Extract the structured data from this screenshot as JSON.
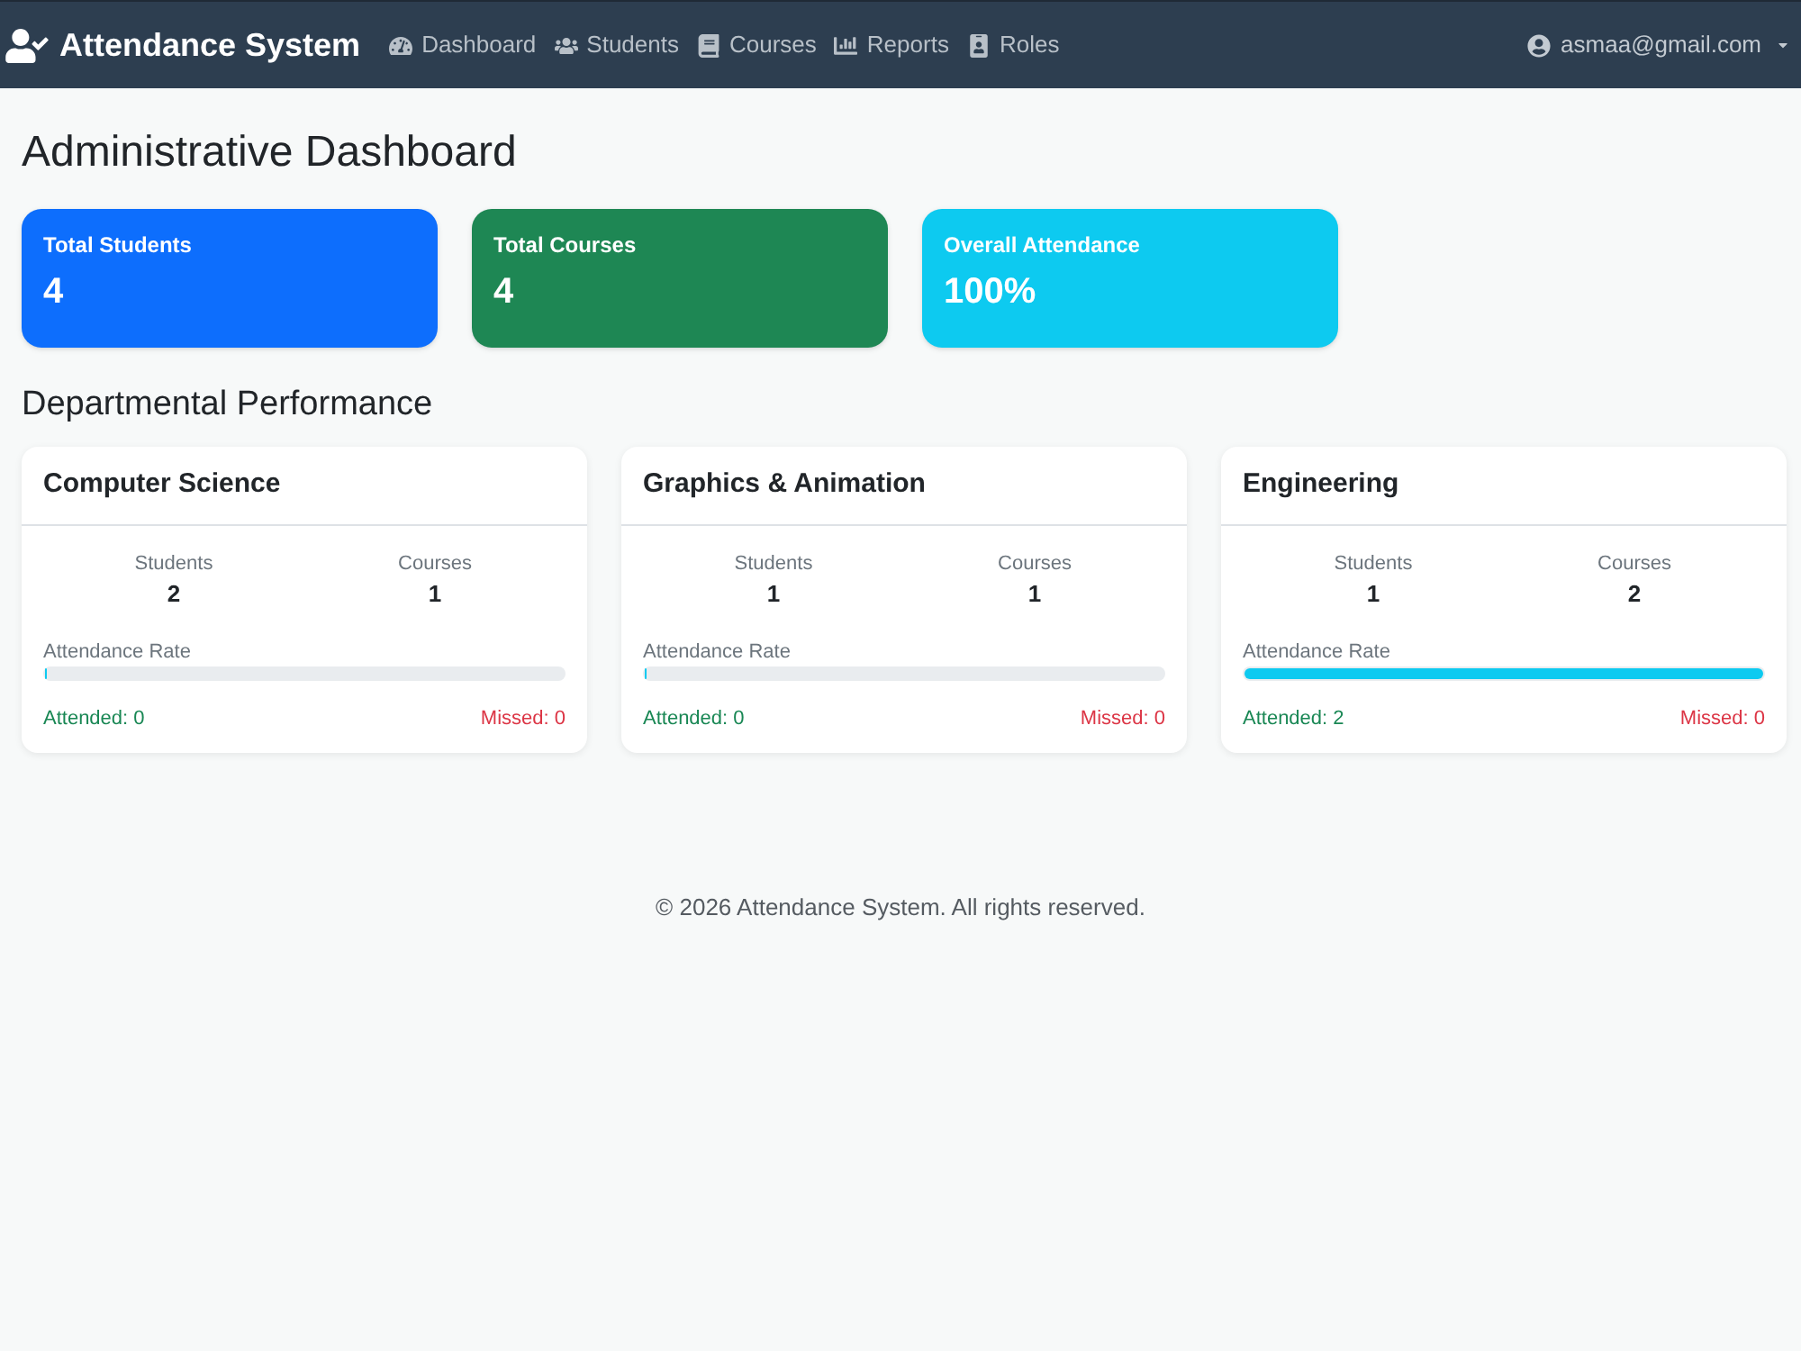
{
  "navbar": {
    "brand": "Attendance System",
    "links": [
      {
        "label": "Dashboard"
      },
      {
        "label": "Students"
      },
      {
        "label": "Courses"
      },
      {
        "label": "Reports"
      },
      {
        "label": "Roles"
      }
    ],
    "user": {
      "email": "asmaa@gmail.com"
    }
  },
  "page_title": "Administrative Dashboard",
  "stats": [
    {
      "label": "Total Students",
      "value": "4",
      "color": "#0d6efd"
    },
    {
      "label": "Total Courses",
      "value": "4",
      "color": "#1e8754"
    },
    {
      "label": "Overall Attendance",
      "value": "100%",
      "color": "#0dcaf0"
    }
  ],
  "departments_heading": "Departmental Performance",
  "departments": [
    {
      "name": "Computer Science",
      "students_label": "Students",
      "students": "2",
      "courses_label": "Courses",
      "courses": "1",
      "rate_label": "Attendance Rate",
      "level": 0,
      "attended": "Attended: 0",
      "missed": "Missed: 0"
    },
    {
      "name": "Graphics & Animation",
      "students_label": "Students",
      "students": "1",
      "courses_label": "Courses",
      "courses": "1",
      "rate_label": "Attendance Rate",
      "level": 0,
      "attended": "Attended: 0",
      "missed": "Missed: 0"
    },
    {
      "name": "Engineering",
      "students_label": "Students",
      "students": "1",
      "courses_label": "Courses",
      "courses": "2",
      "rate_label": "Attendance Rate",
      "level": 1,
      "attended": "Attended: 2",
      "missed": "Missed: 0"
    }
  ],
  "footer": "© 2026 Attendance System. All rights reserved."
}
